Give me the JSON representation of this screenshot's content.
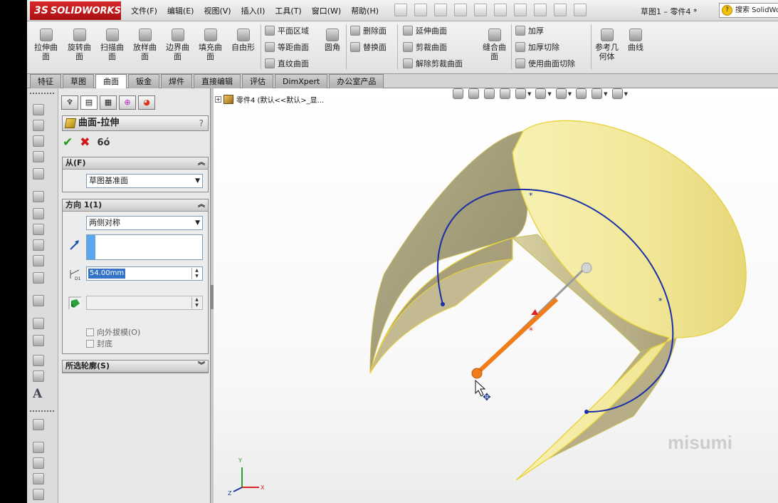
{
  "app": {
    "name": "SOLIDWORKS",
    "logo_mark": "3S",
    "doc_title": "草图1 – 零件4 *",
    "search_placeholder": "搜索 SolidWorks"
  },
  "menu": [
    "文件(F)",
    "编辑(E)",
    "视图(V)",
    "插入(I)",
    "工具(T)",
    "窗口(W)",
    "帮助(H)"
  ],
  "ribbon": {
    "big_buttons": [
      {
        "line1": "拉伸曲",
        "line2": "面",
        "icon": "extruded-surface-icon"
      },
      {
        "line1": "旋转曲",
        "line2": "面",
        "icon": "revolved-surface-icon"
      },
      {
        "line1": "扫描曲",
        "line2": "面",
        "icon": "swept-surface-icon"
      },
      {
        "line1": "放样曲",
        "line2": "面",
        "icon": "lofted-surface-icon"
      },
      {
        "line1": "边界曲",
        "line2": "面",
        "icon": "boundary-surface-icon"
      },
      {
        "line1": "填充曲",
        "line2": "面",
        "icon": "filled-surface-icon"
      },
      {
        "line1": "自由形",
        "line2": "",
        "icon": "freeform-icon"
      }
    ],
    "col_planar": [
      "平面区域",
      "等距曲面",
      "直纹曲面"
    ],
    "fillet": "圆角",
    "col_delete": [
      "删除面",
      "替换面"
    ],
    "col_extend": [
      "延伸曲面",
      "剪裁曲面",
      "解除剪裁曲面"
    ],
    "knit": {
      "line1": "缝合曲",
      "line2": "面"
    },
    "col_thicken": [
      "加厚",
      "加厚切除",
      "使用曲面切除"
    ],
    "ref_geom": {
      "line1": "参考几",
      "line2": "何体"
    },
    "curves": "曲线"
  },
  "tabs": [
    "特征",
    "草图",
    "曲面",
    "钣金",
    "焊件",
    "直接编辑",
    "评估",
    "DimXpert",
    "办公室产品"
  ],
  "active_tab": "曲面",
  "feature_tree": {
    "root": "零件4 (默认<<默认>_显..."
  },
  "property_manager": {
    "title": "曲面-拉伸",
    "help": "?",
    "from_group": {
      "label": "从(F)",
      "value": "草图基准面"
    },
    "direction_group": {
      "label": "方向 1(1)",
      "end_condition": "两侧对称",
      "depth": "54.00mm",
      "draft_outward": "向外拔模(O)",
      "cap_end": "封底"
    },
    "contours_group": {
      "label": "所选轮廓(S)"
    }
  },
  "watermark": "misumi",
  "triad": {
    "x": "X",
    "y": "Y",
    "z": "Z"
  },
  "colors": {
    "accent_red": "#c41a1c",
    "surface_fill": "#f5ee9e",
    "sketch_blue": "#1a2fa6",
    "handle_orange": "#f07c1a"
  }
}
